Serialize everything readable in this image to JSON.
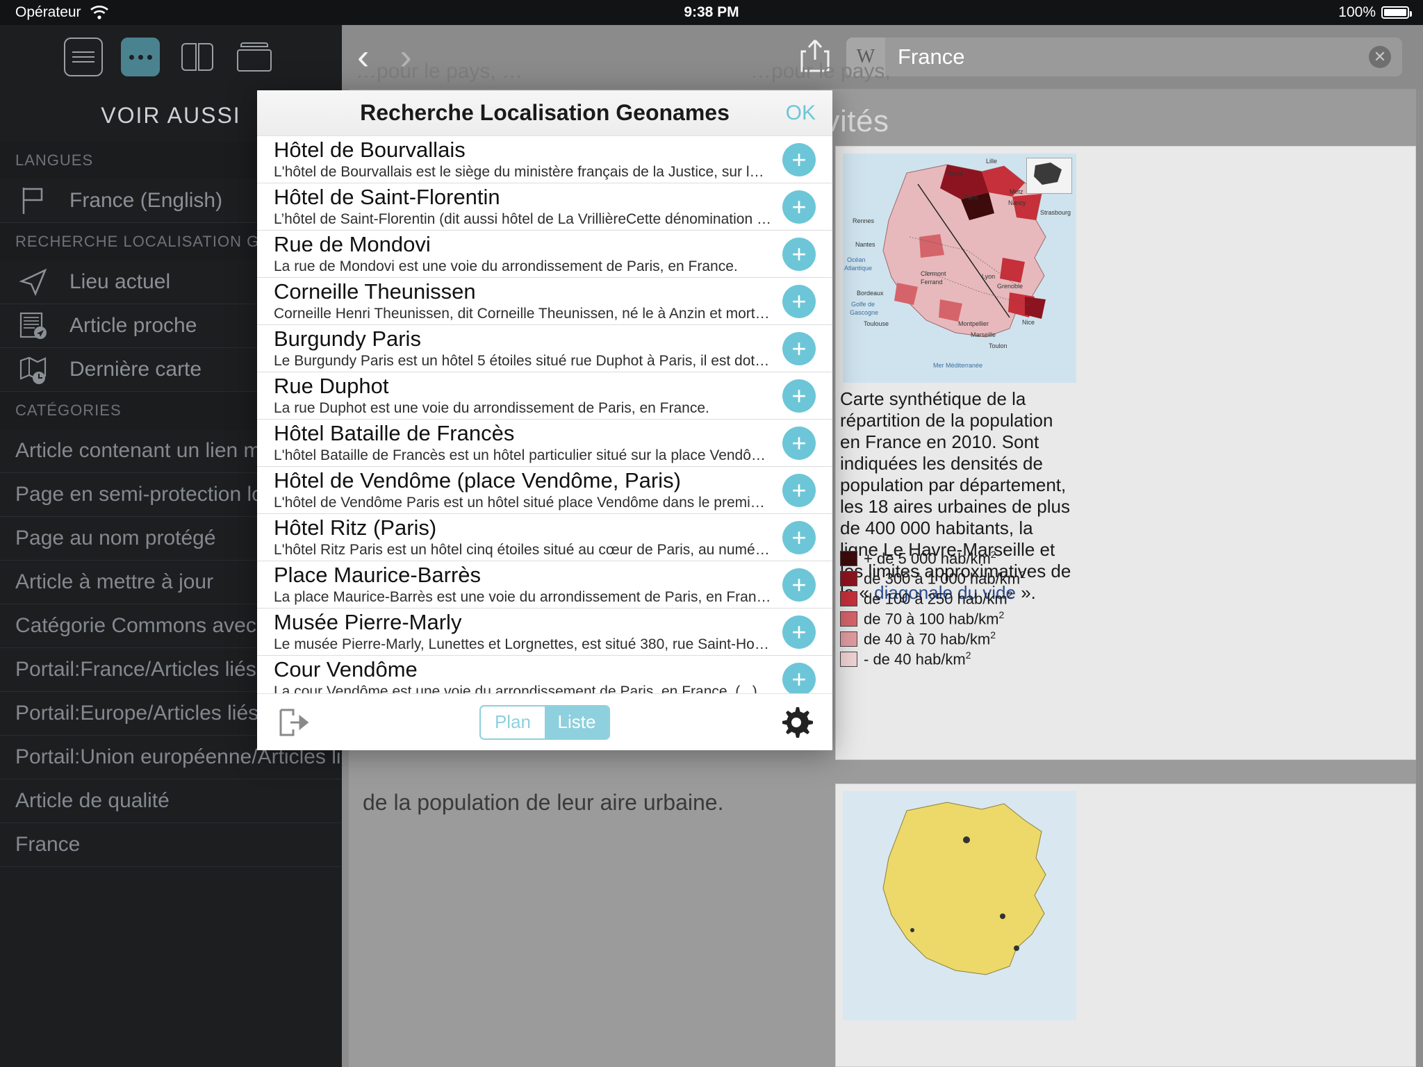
{
  "status_bar": {
    "carrier": "Opérateur",
    "wifi_icon": "wifi-icon",
    "time": "9:38 PM",
    "battery_percent": "100%"
  },
  "browser": {
    "back_label": "‹",
    "forward_label": "›",
    "share_icon": "share-icon",
    "wiki_badge": "W",
    "url_value": "France",
    "clear_icon": "✕"
  },
  "sidebar": {
    "toolbar": [
      {
        "name": "list-view-icon",
        "label": "Sommaire",
        "active": false
      },
      {
        "name": "more-view-icon",
        "label": "Plus",
        "active": true
      },
      {
        "name": "book-view-icon",
        "label": "Lecture",
        "active": false
      },
      {
        "name": "archive-view-icon",
        "label": "Archives",
        "active": false
      }
    ],
    "title": "VOIR AUSSI",
    "sections": [
      {
        "header": "LANGUES",
        "items": [
          {
            "icon": "flag-icon",
            "label": "France (English)"
          }
        ]
      },
      {
        "header": "RECHERCHE LOCALISATION GEONAMES",
        "items": [
          {
            "icon": "location-arrow-icon",
            "label": "Lieu actuel"
          },
          {
            "icon": "nearby-article-icon",
            "label": "Article proche"
          },
          {
            "icon": "recent-map-icon",
            "label": "Dernière carte"
          }
        ]
      },
      {
        "header": "CATÉGORIES",
        "items": [
          {
            "icon": "",
            "label": "Article contenant un lien mort"
          },
          {
            "icon": "",
            "label": "Page en semi-protection longue"
          },
          {
            "icon": "",
            "label": "Page au nom protégé"
          },
          {
            "icon": "",
            "label": "Article à mettre à jour"
          },
          {
            "icon": "",
            "label": "Catégorie Commons avec lien local différent sur Wikidata"
          },
          {
            "icon": "",
            "label": "Portail:France/Articles liés"
          },
          {
            "icon": "",
            "label": "Portail:Europe/Articles liés"
          },
          {
            "icon": "",
            "label": "Portail:Union européenne/Articles liés"
          },
          {
            "icon": "",
            "label": "Article de qualité"
          },
          {
            "icon": "",
            "label": "France"
          }
        ]
      }
    ]
  },
  "modal": {
    "title": "Recherche Localisation Geonames",
    "ok_label": "OK",
    "add_icon": "plus-icon",
    "export_icon": "export-icon",
    "settings_icon": "gear-icon",
    "segmented": {
      "options": [
        "Plan",
        "Liste"
      ],
      "selected": "Liste"
    },
    "results": [
      {
        "title": "Hôtel de Bourvallais",
        "description": "L'hôtel de Bourvallais est le siège du ministère français de la Justice, sur la place Vend…"
      },
      {
        "title": "Hôtel de Saint-Florentin",
        "description": "L’hôtel de Saint-Florentin (dit aussi hôtel de La VrillièreCette dénomination s'applique…"
      },
      {
        "title": "Rue de Mondovi",
        "description": "La rue de Mondovi est une voie du arrondissement de Paris, en France."
      },
      {
        "title": "Corneille Theunissen",
        "description": "Corneille Henri Theunissen, dit Corneille Theunissen, né le à Anzin et mort le à Paris, e…"
      },
      {
        "title": "Burgundy Paris",
        "description": "Le Burgundy Paris est un hôtel 5 étoiles situé rue Duphot à Paris, il est doté de 51 cha…"
      },
      {
        "title": "Rue Duphot",
        "description": "La rue Duphot est une voie du arrondissement de Paris, en France."
      },
      {
        "title": "Hôtel Bataille de Francès",
        "description": "L'hôtel Bataille de Francès est un hôtel particulier situé sur la place Vendôme à Paris, e…"
      },
      {
        "title": "Hôtel de Vendôme (place Vendôme, Paris)",
        "description": "L'hôtel de Vendôme Paris est un hôtel situé place Vendôme dans le premier arrondiss…"
      },
      {
        "title": "Hôtel Ritz (Paris)",
        "description": "L'hôtel Ritz Paris est un hôtel cinq étoiles situé au cœur de Paris, au numéro 15 place…"
      },
      {
        "title": "Place Maurice-Barrès",
        "description": "La place Maurice-Barrès est une voie du arrondissement de Paris, en France."
      },
      {
        "title": "Musée Pierre-Marly",
        "description": "Le musée Pierre-Marly, Lunettes et Lorgnettes, est situé 380, rue Saint-Honoré dans le…"
      },
      {
        "title": "Cour Vendôme",
        "description": "La cour Vendôme est une voie du arrondissement de Paris, en France.  (...)"
      }
    ]
  },
  "article": {
    "heading": "…vités",
    "caption_pre": "Carte synthétique de la répartition de la population en France en 2010. Sont indiquées les densités de population par département, les 18 aires urbaines de plus de 400 000 habitants, la ligne Le Havre-Marseille et les limites approximatives de la « ",
    "caption_link": "diagonale du vide",
    "caption_post": " ».",
    "bottom_sentence": "de la population de leur aire urbaine.",
    "map_labels": [
      "Lille",
      "Douai",
      "Paris",
      "Metz",
      "Nancy",
      "Strasbourg",
      "Rennes",
      "Nantes",
      "Clermont-Ferrand",
      "Lyon",
      "Grenoble",
      "Bordeaux",
      "Toulouse",
      "Montpellier",
      "Marseille",
      "Nice",
      "Toulon",
      "Océan Atlantique",
      "Golfe de Gascogne",
      "Mer Méditerranée"
    ],
    "legend": [
      {
        "color": "#3d0b0b",
        "label": "+ de 5 000 hab/km",
        "exp": "2"
      },
      {
        "color": "#8c1420",
        "label": "de 300 à 1 000 hab/km",
        "exp": "2"
      },
      {
        "color": "#c5303a",
        "label": "de 100 à 250 hab/km",
        "exp": "2"
      },
      {
        "color": "#d4646a",
        "label": "de 70 à 100 hab/km",
        "exp": "2"
      },
      {
        "color": "#e09ca0",
        "label": "de 40 à 70 hab/km",
        "exp": "2"
      },
      {
        "color": "#f0d3d5",
        "label": "- de 40 hab/km",
        "exp": "2"
      }
    ]
  },
  "colors": {
    "accent": "#6cc6d8",
    "sidebar_bg": "#1c1e20",
    "status_bg": "#111315"
  }
}
